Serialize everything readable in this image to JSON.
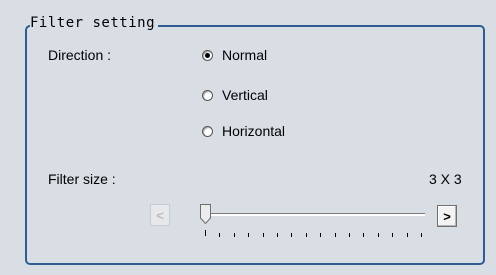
{
  "group": {
    "title": "Filter setting"
  },
  "direction": {
    "label": "Direction :",
    "options": [
      {
        "label": "Normal",
        "selected": true
      },
      {
        "label": "Vertical",
        "selected": false
      },
      {
        "label": "Horizontal",
        "selected": false
      }
    ]
  },
  "filter_size": {
    "label": "Filter size :",
    "value_text": "3 X 3",
    "decrease_label": "<",
    "increase_label": ">",
    "slider_position": 0
  },
  "colors": {
    "panel_bg": "#d9dee5",
    "group_border": "#2d5d93"
  }
}
